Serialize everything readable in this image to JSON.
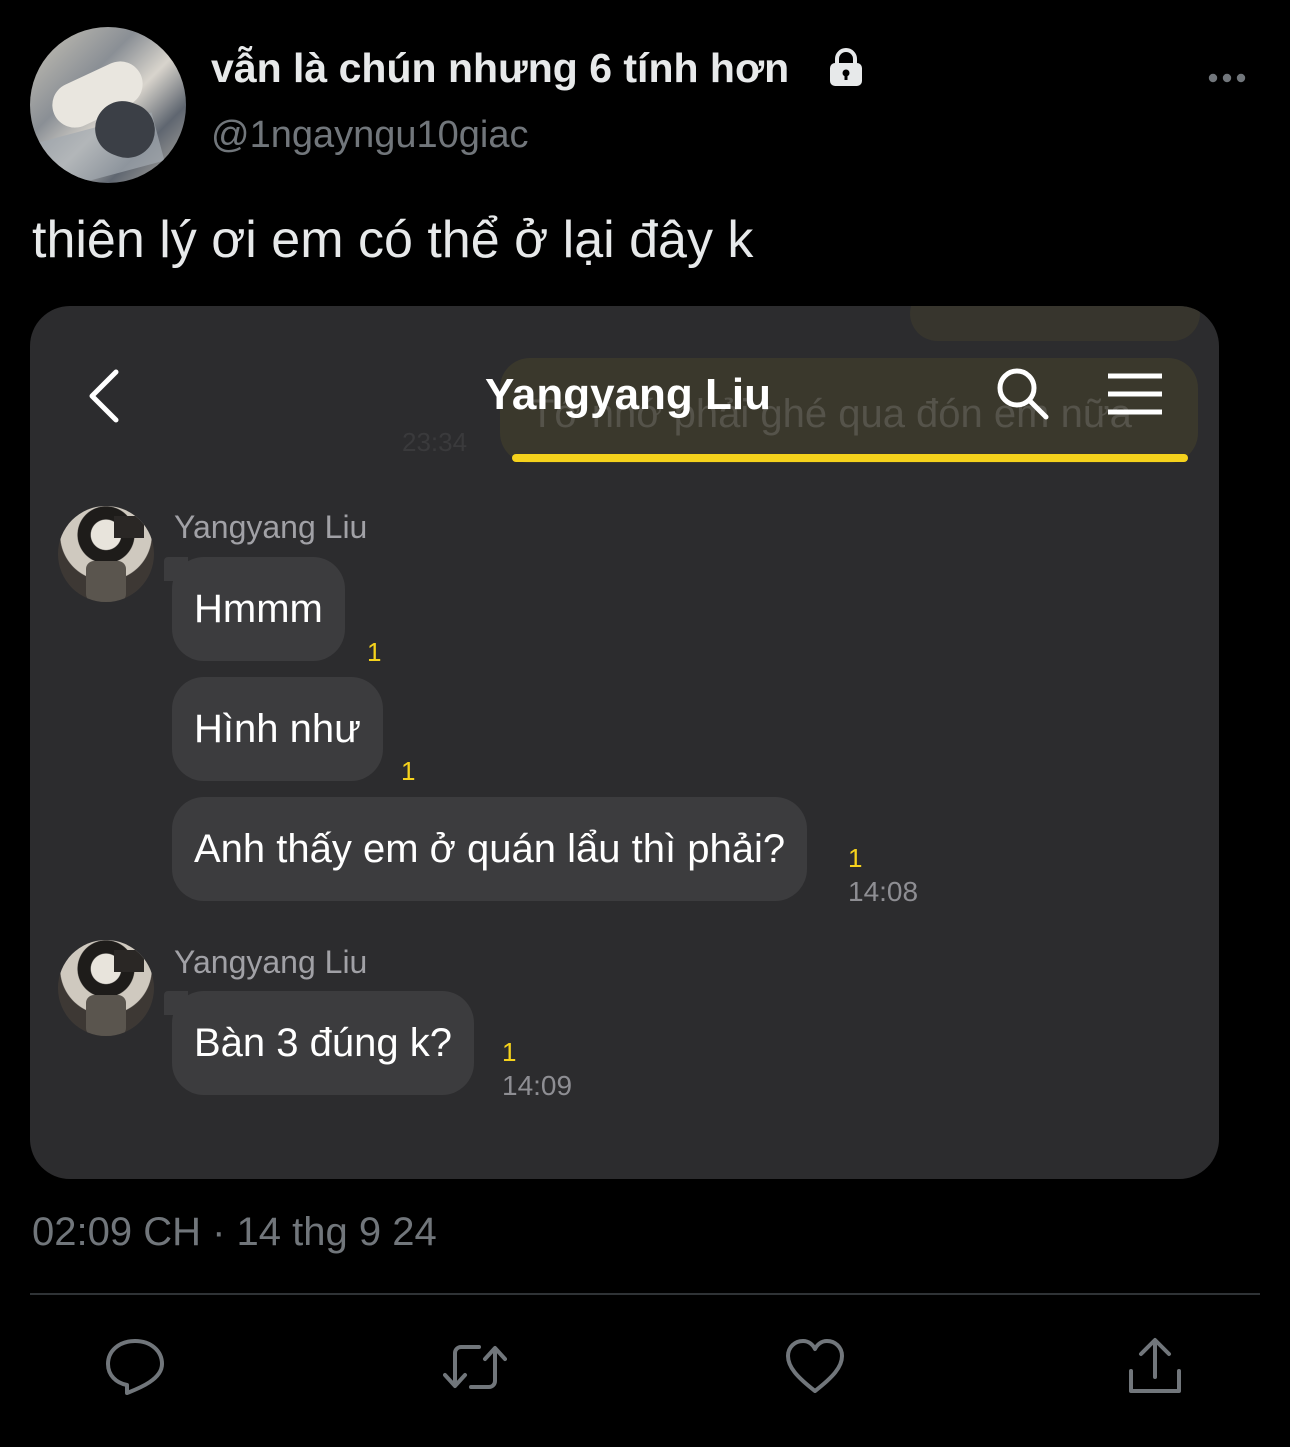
{
  "author": {
    "display_name": "vẫn là chún nhưng 6 tính hơn",
    "handle": "@1ngayngu10giac",
    "avatar_icon": "profile-photo",
    "protected_icon": "lock-icon"
  },
  "tweet": {
    "text": "thiên lý ơi em có thể ở lại đây k",
    "timestamp": "02:09 CH · 14 thg 9 24"
  },
  "chat": {
    "title": "Yangyang Liu",
    "ghost_message": "Tớ nhớ phải ghé qua đón em nữa",
    "ghost_time": "23:34",
    "groups": [
      {
        "sender": "Yangyang Liu",
        "messages": [
          {
            "text": "Hmmm",
            "unread": "1"
          },
          {
            "text": "Hình như",
            "unread": "1"
          },
          {
            "text": "Anh thấy em ở quán lẩu thì phải?",
            "unread": "1",
            "time": "14:08"
          }
        ]
      },
      {
        "sender": "Yangyang Liu",
        "messages": [
          {
            "text": "Bàn 3 đúng k?",
            "unread": "1",
            "time": "14:09"
          }
        ]
      }
    ]
  },
  "colors": {
    "background": "#000000",
    "card": "#2c2c2e",
    "bubble": "#3c3c3e",
    "accent_yellow": "#f5d21c",
    "muted": "#71767b"
  },
  "actions": [
    "reply-icon",
    "retweet-icon",
    "like-icon",
    "share-icon"
  ]
}
